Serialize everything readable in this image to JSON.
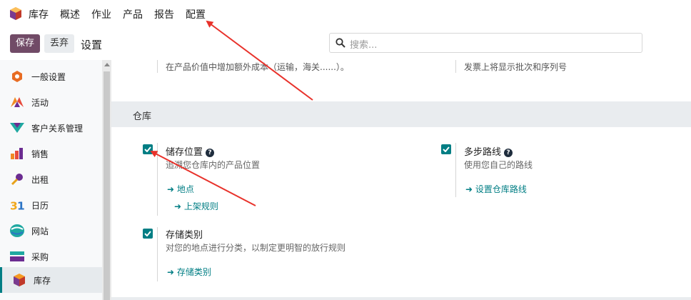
{
  "topbar": {
    "menu": [
      "库存",
      "概述",
      "作业",
      "产品",
      "报告",
      "配置"
    ]
  },
  "controls": {
    "save_label": "保存",
    "discard_label": "丢弃",
    "settings_title": "设置",
    "search_placeholder": "搜索..."
  },
  "sidebar": {
    "items": [
      {
        "label": "一般设置",
        "icon": "odoo-general-icon"
      },
      {
        "label": "活动",
        "icon": "activity-icon"
      },
      {
        "label": "客户关系管理",
        "icon": "crm-icon"
      },
      {
        "label": "销售",
        "icon": "sales-icon"
      },
      {
        "label": "出租",
        "icon": "rental-icon"
      },
      {
        "label": "日历",
        "icon": "calendar-icon"
      },
      {
        "label": "网站",
        "icon": "website-icon"
      },
      {
        "label": "采购",
        "icon": "purchase-icon"
      },
      {
        "label": "库存",
        "icon": "inventory-icon",
        "active": true
      }
    ]
  },
  "main": {
    "top_left_desc": "在产品价值中增加额外成本（运输，海关......）。",
    "top_right_desc": "发票上将显示批次和序列号",
    "section_title": "仓库",
    "options": {
      "storage_locations": {
        "title": "储存位置",
        "desc": "追溯您仓库内的产品位置",
        "links": [
          "地点",
          "上架规则"
        ],
        "checked": true
      },
      "multi_step_routes": {
        "title": "多步路线",
        "desc": "使用您自己的路线",
        "links": [
          "设置仓库路线"
        ],
        "checked": true
      },
      "storage_categories": {
        "title": "存储类别",
        "desc": "对您的地点进行分类，以制定更明智的放行规则",
        "links": [
          "存储类别"
        ],
        "checked": true
      }
    }
  },
  "colors": {
    "accent": "#017e84",
    "brand": "#714b67",
    "annotation": "#e8322b"
  }
}
